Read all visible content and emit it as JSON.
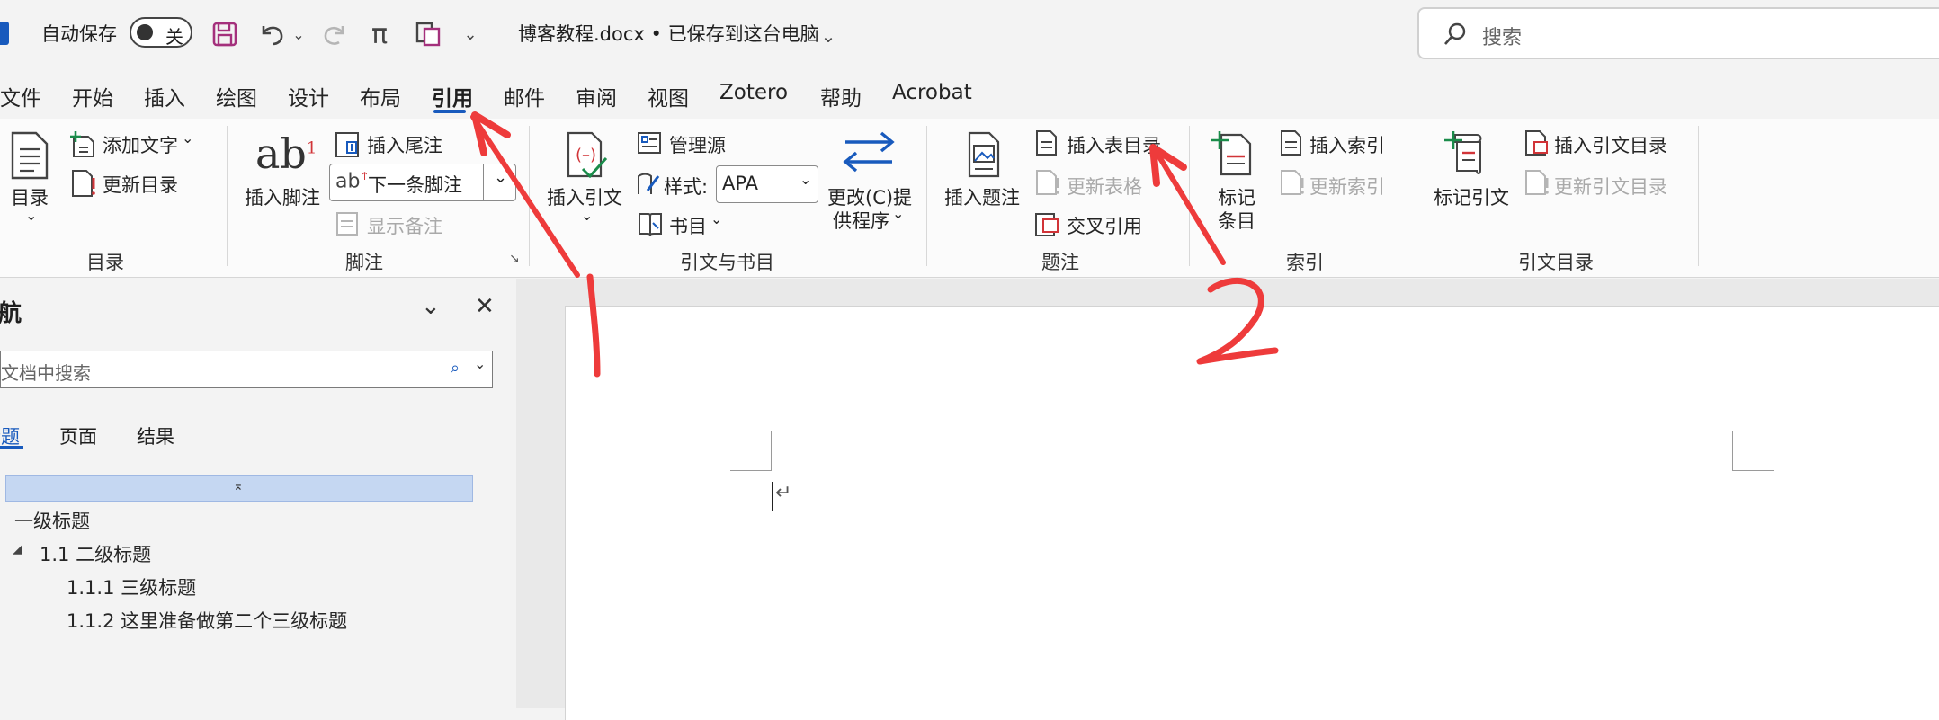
{
  "titlebar": {
    "autosave_label": "自动保存",
    "autosave_toggle_label": "关",
    "document_title": "博客教程.docx • 已保存到这台电脑",
    "search_placeholder": "搜索"
  },
  "ribbon_tabs": [
    {
      "label": "文件"
    },
    {
      "label": "开始"
    },
    {
      "label": "插入"
    },
    {
      "label": "绘图"
    },
    {
      "label": "设计"
    },
    {
      "label": "布局"
    },
    {
      "label": "引用",
      "active": true
    },
    {
      "label": "邮件"
    },
    {
      "label": "审阅"
    },
    {
      "label": "视图"
    },
    {
      "label": "Zotero"
    },
    {
      "label": "帮助"
    },
    {
      "label": "Acrobat"
    }
  ],
  "ribbon": {
    "toc_group": {
      "label": "目录",
      "toc_button": "目录",
      "add_text": "添加文字",
      "update_toc": "更新目录"
    },
    "footnote_group": {
      "label": "脚注",
      "insert_footnote": "插入脚注",
      "footnote_icon_text": "ab",
      "footnote_superscript": "1",
      "insert_endnote": "插入尾注",
      "next_footnote": "下一条脚注",
      "show_notes": "显示备注"
    },
    "citation_group": {
      "label": "引文与书目",
      "insert_citation": "插入引文",
      "manage_sources": "管理源",
      "style_label": "样式:",
      "style_value": "APA",
      "bibliography": "书目",
      "change_provider_line1": "更改(C)提",
      "change_provider_line2": "供程序"
    },
    "caption_group": {
      "label": "题注",
      "insert_caption": "插入题注",
      "insert_table_of_figures": "插入表目录",
      "update_table": "更新表格",
      "cross_reference": "交叉引用"
    },
    "index_group": {
      "label": "索引",
      "mark_entry_line1": "标记",
      "mark_entry_line2": "条目",
      "insert_index": "插入索引",
      "update_index": "更新索引"
    },
    "authorities_group": {
      "label": "引文目录",
      "mark_citation": "标记引文",
      "insert_table_of_authorities": "插入引文目录",
      "update_table_of_authorities": "更新引文目录"
    }
  },
  "navigation": {
    "title": "导航",
    "search_placeholder": "在文档中搜索",
    "tabs": [
      {
        "label": "标题",
        "active": true
      },
      {
        "label": "页面"
      },
      {
        "label": "结果"
      }
    ],
    "headings": [
      {
        "label": "一级标题"
      },
      {
        "label": "1.1 二级标题"
      },
      {
        "label": "1.1.1 三级标题"
      },
      {
        "label": "1.1.2 这里准备做第二个三级标题"
      }
    ]
  },
  "annotations": {
    "colors": {
      "arrow": "#ee3b3b"
    }
  },
  "colors": {
    "accent": "#185abd",
    "save_icon": "#a4307c"
  }
}
